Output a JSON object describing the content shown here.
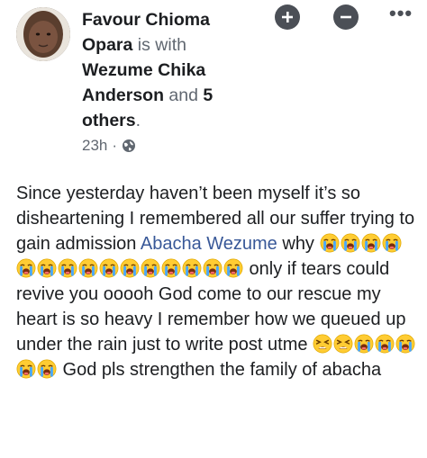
{
  "post": {
    "author": "Favour Chioma Opara",
    "with_text": " is with ",
    "tagged": "Wezume Chika Anderson",
    "and_text": " and ",
    "others": "5 others",
    "period": ".",
    "time": "23h",
    "separator": "·",
    "privacy_icon": "globe-icon",
    "body": {
      "text1": "Since yesterday haven’t been myself it’s so disheartening I remembered all our suffer trying to gain admission ",
      "mention": "Abacha Wezume",
      "text2": " why ",
      "text3": " only if tears could revive you ooooh God come to our rescue my heart is so heavy I remember how we queued up under the rain just to write post utme ",
      "text4": " God pls strengthen the family of abacha"
    },
    "emoji_names": [
      "loudly-crying-face",
      "tired-face"
    ]
  },
  "header_actions": {
    "add_icon": "plus-circle-icon",
    "remove_icon": "minus-circle-icon",
    "more_label": "•••"
  }
}
